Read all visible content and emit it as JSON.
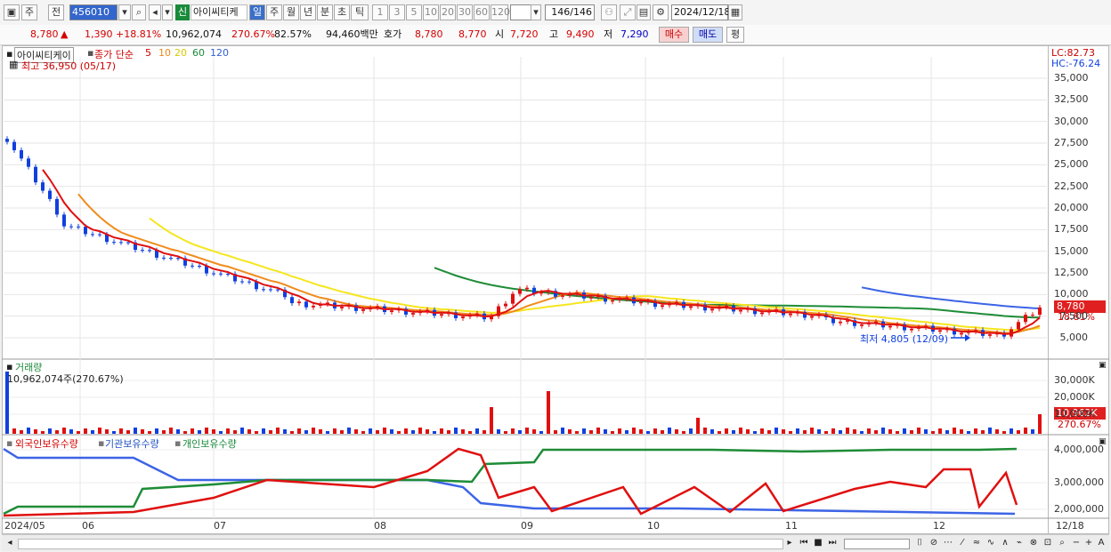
{
  "toolbar": {
    "kind1": "주",
    "kind2": "전",
    "code": "456010",
    "new_badge": "신",
    "name": "아이씨티케",
    "periods": [
      "일",
      "주",
      "월",
      "년",
      "분",
      "초",
      "틱"
    ],
    "active_period": "일",
    "nums": [
      "1",
      "3",
      "5",
      "10",
      "20",
      "30",
      "60",
      "120"
    ],
    "count": "146/146",
    "date": "2024/12/18"
  },
  "quote": {
    "price": "8,780",
    "arrow": "▲",
    "change": "1,390",
    "pct": "+18.81%",
    "volume": "10,962,074",
    "vol_ratio": "270.67%",
    "turnover": "82.57%",
    "amount": "94,460백만",
    "hoga_label": "호가",
    "ask": "8,780",
    "bid": "8,770",
    "open_label": "시",
    "open": "7,720",
    "high_label": "고",
    "high": "9,490",
    "low_label": "저",
    "low": "7,290",
    "buy": "매수",
    "sell": "매도",
    "avg": "평"
  },
  "price_panel": {
    "name": "아이씨티케이",
    "ma_label": "종가 단순",
    "ma_periods": [
      "5",
      "10",
      "20",
      "60",
      "120"
    ],
    "max_label": "최고 36,950 (05/17)",
    "min_label": "최저 4,805 (12/09)",
    "lc": "LC:82.73",
    "hc": "HC:-76.24",
    "y_ticks": [
      "35,000",
      "32,500",
      "30,000",
      "27,500",
      "25,000",
      "22,500",
      "20,000",
      "17,500",
      "15,000",
      "12,500",
      "10,000",
      "7,500",
      "5,000"
    ],
    "cur_price": "8,780",
    "cur_pct": "18.81%"
  },
  "volume_panel": {
    "title": "거래량",
    "value": "10,962,074주(270.67%)",
    "y_ticks": [
      "30,000K",
      "20,000K",
      "10,000K"
    ],
    "cur": "10,962K",
    "cur_pct": "270.67%"
  },
  "holding_panel": {
    "series": [
      "외국인보유수량",
      "기관보유수량",
      "개인보유수량"
    ],
    "y_ticks": [
      "4,000,000",
      "3,000,000",
      "2,000,000"
    ]
  },
  "x_axis": {
    "labels": [
      "2024/05",
      "06",
      "07",
      "08",
      "09",
      "10",
      "11",
      "12",
      "12/18"
    ]
  },
  "colors": {
    "up": "#e01010",
    "down": "#1040e0",
    "ma5": "#e01010",
    "ma10": "#f08c1e",
    "ma20": "#f5e61e",
    "ma60": "#1e8c37",
    "ma120": "#3c64e6"
  }
}
